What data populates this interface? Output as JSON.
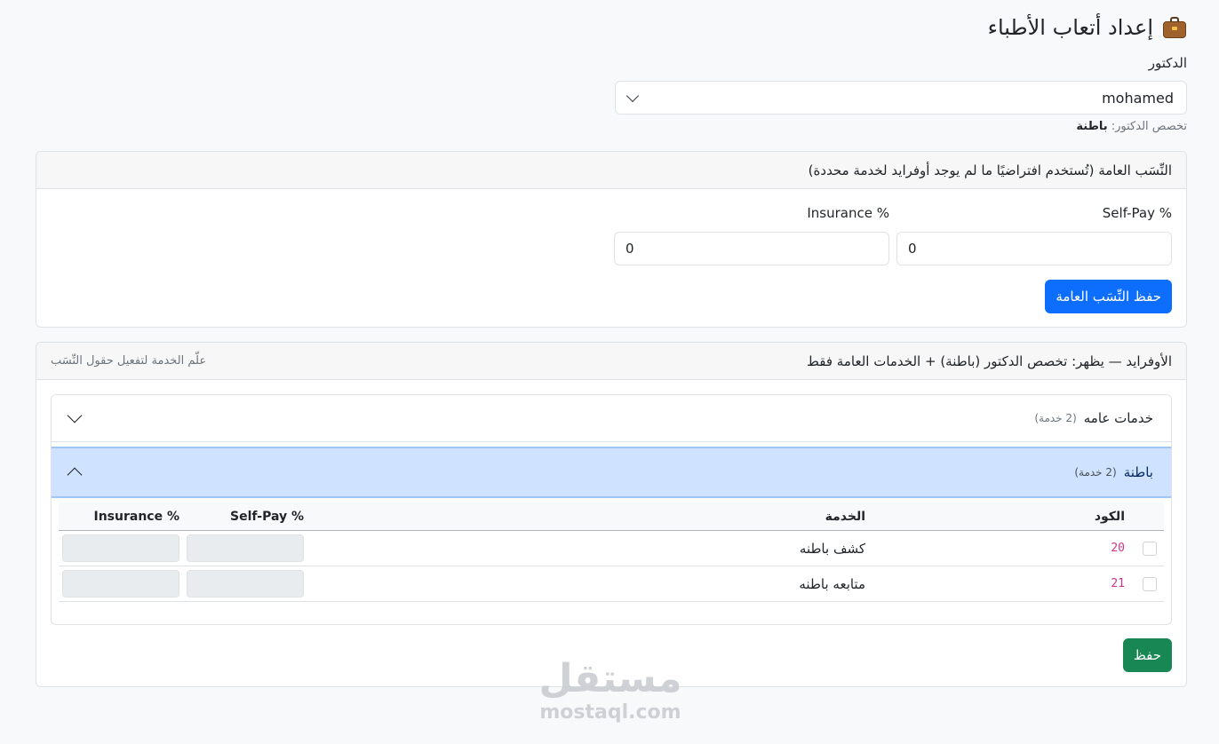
{
  "header": {
    "title": "إعداد أتعاب الأطباء",
    "icon": "briefcase-icon"
  },
  "doctor": {
    "label": "الدكتور",
    "selected": "mohamed",
    "specialty_prefix": "تخصص الدكتور:",
    "specialty": "باطنة"
  },
  "general_rates": {
    "header": "النِّسَب العامة (تُستخدم افتراضيًا ما لم يوجد أوفرايد لخدمة محددة)",
    "self_pay_label": "Self-Pay %",
    "self_pay_value": "0",
    "insurance_label": "Insurance %",
    "insurance_value": "0",
    "save_label": "حفظ النِّسَب العامة"
  },
  "override": {
    "header": "الأوفرايد — يظهر: تخصص الدكتور (باطنة) + الخدمات العامة فقط",
    "hint": "علّم الخدمة لتفعيل حقول النِّسَب",
    "groups": [
      {
        "title": "خدمات عامه",
        "count": "(2 خدمة)",
        "expanded": false
      },
      {
        "title": "باطنة",
        "count": "(2 خدمة)",
        "expanded": true
      }
    ],
    "table": {
      "headers": {
        "code": "الكود",
        "service": "الخدمة",
        "self_pay": "Self-Pay %",
        "insurance": "Insurance %"
      },
      "rows": [
        {
          "code": "20",
          "service": "كشف باطنه"
        },
        {
          "code": "21",
          "service": "متابعه باطنه"
        }
      ]
    },
    "save_label": "حفظ"
  },
  "watermark": {
    "ar": "مستقل",
    "en": "mostaql.com"
  },
  "colors": {
    "primary": "#0d6efd",
    "success": "#198754",
    "accordion_active": "#cfe2ff",
    "code": "#d63384"
  }
}
